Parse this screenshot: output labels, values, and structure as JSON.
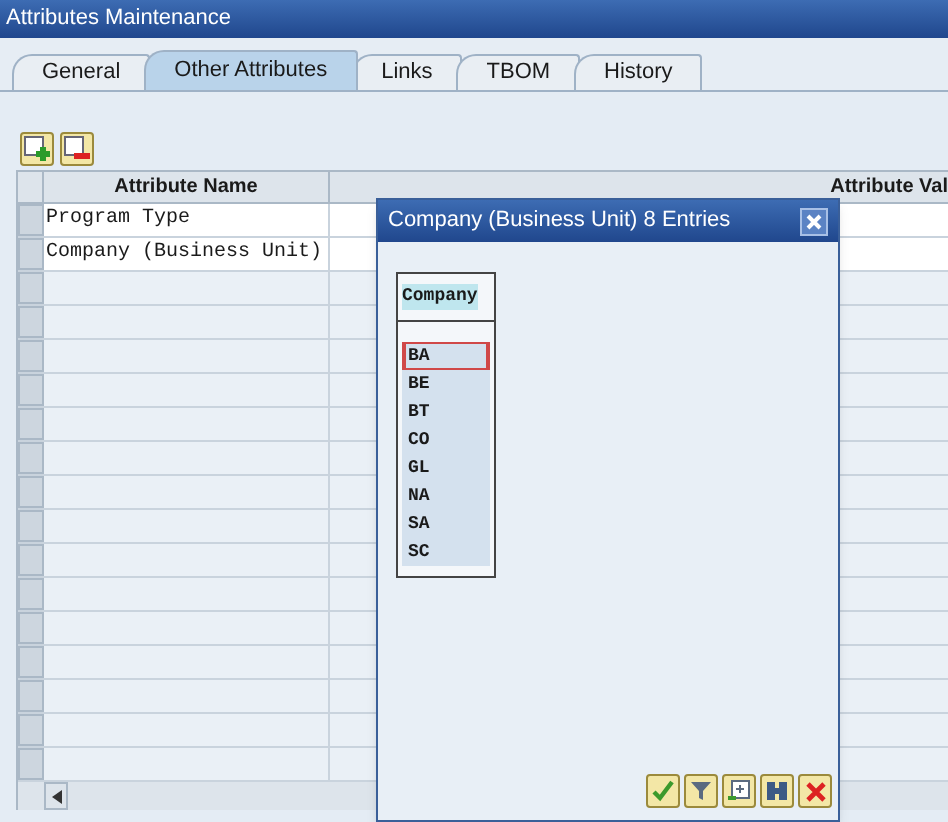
{
  "window": {
    "title": "Attributes Maintenance"
  },
  "tabs": [
    {
      "label": "General",
      "selected": false
    },
    {
      "label": "Other Attributes",
      "selected": true
    },
    {
      "label": "Links",
      "selected": false
    },
    {
      "label": "TBOM",
      "selected": false
    },
    {
      "label": "History",
      "selected": false
    }
  ],
  "table": {
    "columns": [
      "Attribute Name",
      "Attribute Val"
    ],
    "rows": [
      {
        "name": "Program Type"
      },
      {
        "name": "Company (Business Unit)"
      }
    ]
  },
  "popup": {
    "title": "Company (Business Unit) 8 Entries",
    "column": "Company",
    "entries": [
      {
        "value": "BA",
        "selected": true
      },
      {
        "value": "BE",
        "selected": false
      },
      {
        "value": "BT",
        "selected": false
      },
      {
        "value": "CO",
        "selected": false
      },
      {
        "value": "GL",
        "selected": false
      },
      {
        "value": "NA",
        "selected": false
      },
      {
        "value": "SA",
        "selected": false
      },
      {
        "value": "SC",
        "selected": false
      }
    ]
  }
}
